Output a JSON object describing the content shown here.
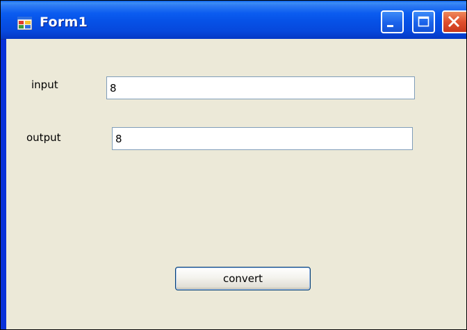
{
  "window": {
    "title": "Form1",
    "title_icon": "form-app-icon",
    "controls": {
      "minimize_icon": "minimize-icon",
      "maximize_icon": "maximize-icon",
      "close_icon": "close-icon"
    }
  },
  "form": {
    "input": {
      "label": "input",
      "value": "8"
    },
    "output": {
      "label": "output",
      "value": "8"
    },
    "convert_button_label": "convert"
  },
  "colors": {
    "titlebar_blue": "#0054e3",
    "client_background": "#ece9d8",
    "close_button_red": "#e0502e",
    "textbox_border": "#7f9db9"
  }
}
